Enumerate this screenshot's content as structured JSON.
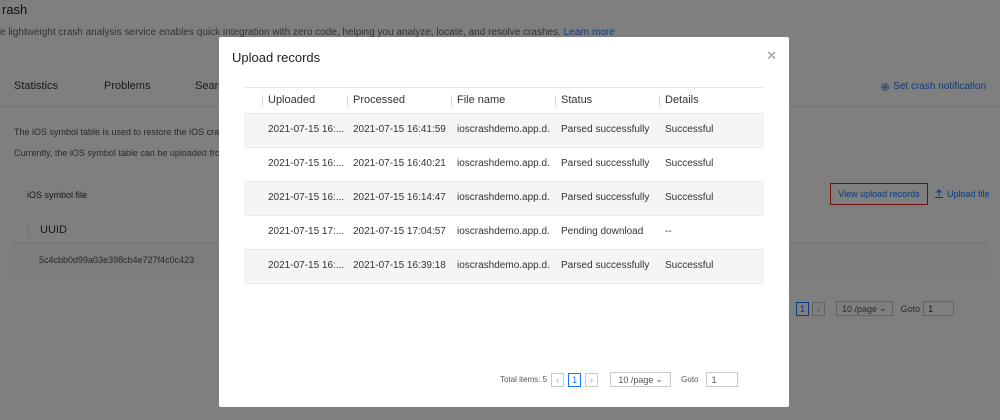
{
  "background": {
    "title": "rash",
    "description": "e lightweight crash analysis service enables quick integration with zero code, helping you analyze, locate, and resolve crashes.",
    "learn_more": "Learn more",
    "tabs": [
      "Statistics",
      "Problems",
      "Searc"
    ],
    "set_notification": "Set crash notification",
    "text1": "The iOS symbol table is used to restore the iOS crash",
    "text2": "Currently, the iOS symbol table can be uploaded from",
    "symbol_file_label": "iOS symbol file",
    "view_upload_records": "View upload records",
    "upload_file": "Upload file",
    "table_header": "UUID",
    "row_uuid": "5c4cbb0d99a03e398cb4e727f4c0c423",
    "pager": {
      "page": "1",
      "page_size": "10 /page",
      "goto_label": "Goto",
      "goto_value": "1"
    }
  },
  "modal": {
    "title": "Upload records",
    "close_icon": "close-icon",
    "columns": [
      "Uploaded",
      "Processed",
      "File name",
      "Status",
      "Details"
    ],
    "rows": [
      {
        "uploaded": "2021-07-15 16:...",
        "processed": "2021-07-15 16:41:59",
        "file": "ioscrashdemo.app.d...",
        "status": "Parsed successfully",
        "details": "Successful"
      },
      {
        "uploaded": "2021-07-15 16:...",
        "processed": "2021-07-15 16:40:21",
        "file": "ioscrashdemo.app.d...",
        "status": "Parsed successfully",
        "details": "Successful"
      },
      {
        "uploaded": "2021-07-15 16:...",
        "processed": "2021-07-15 16:14:47",
        "file": "ioscrashdemo.app.d...",
        "status": "Parsed successfully",
        "details": "Successful"
      },
      {
        "uploaded": "2021-07-15 17:...",
        "processed": "2021-07-15 17:04:57",
        "file": "ioscrashdemo.app.d...",
        "status": "Pending download",
        "details": "--"
      },
      {
        "uploaded": "2021-07-15 16:...",
        "processed": "2021-07-15 16:39:18",
        "file": "ioscrashdemo.app.d...",
        "status": "Parsed successfully",
        "details": "Successful"
      }
    ],
    "pager": {
      "total_label": "Total items: 5",
      "page": "1",
      "page_size": "10 /page",
      "goto_label": "Goto",
      "goto_value": "1"
    }
  },
  "colors": {
    "accent": "#1677ff",
    "highlight_border": "#e02020",
    "overlay": "rgba(0,0,0,0.5)"
  }
}
